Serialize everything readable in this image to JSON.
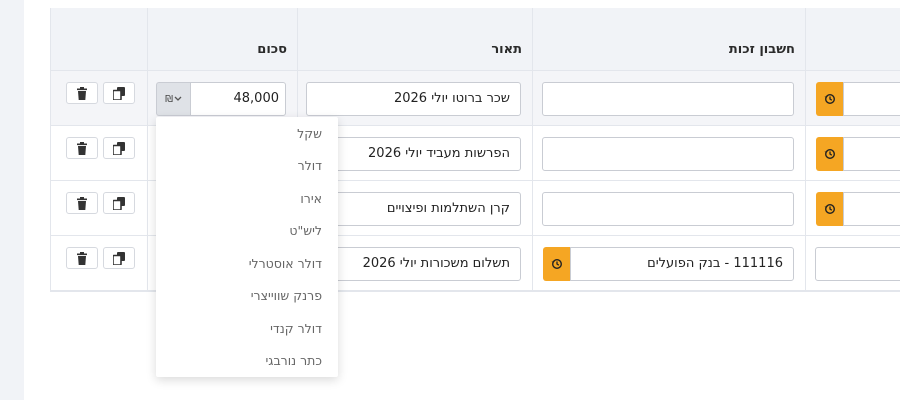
{
  "table": {
    "headers": {
      "amount": "סכום",
      "description": "תאור",
      "credit_account": "חשבון זכות"
    },
    "rows": [
      {
        "amount": "48,000",
        "description": "שכר ברוטו יולי 2026",
        "credit_account": ""
      },
      {
        "amount": "",
        "description": "הפרשות מעביד יולי 2026",
        "credit_account": ""
      },
      {
        "amount": "",
        "description": "קרן השתלמות ופיצויים",
        "credit_account": ""
      },
      {
        "amount": "",
        "description": "תשלום משכורות יולי 2026",
        "credit_account": "111116 - בנק הפועלים"
      }
    ]
  },
  "currency": {
    "selected": "₪",
    "options": [
      "שקל",
      "דולר",
      "אירו",
      "ליש\"ט",
      "דולר אוסטרלי",
      "פרנק שווייצרי",
      "דולר קנדי",
      "כתר נורבגי"
    ]
  },
  "colors": {
    "accent": "#f5a623",
    "header_bg": "#f1f3f7",
    "border": "#c9ccd3"
  },
  "icons": {
    "copy": "copy-icon",
    "delete": "trash-icon",
    "history": "history-icon",
    "dropdown": "chevron-down-icon"
  }
}
